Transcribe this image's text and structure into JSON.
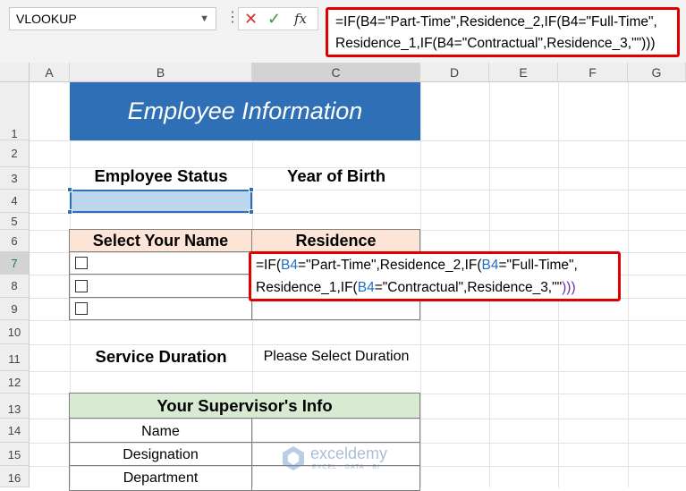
{
  "name_box": {
    "value": "VLOOKUP"
  },
  "formula_bar": {
    "line1": "=IF(B4=\"Part-Time\",Residence_2,IF(B4=\"Full-Time\",",
    "line2": "Residence_1,IF(B4=\"Contractual\",Residence_3,\"\")))"
  },
  "columns": [
    "A",
    "B",
    "C",
    "D",
    "E",
    "F",
    "G"
  ],
  "rows": [
    "1",
    "2",
    "3",
    "4",
    "5",
    "6",
    "7",
    "8",
    "9",
    "10",
    "11",
    "12",
    "13",
    "14",
    "15",
    "16"
  ],
  "sheet": {
    "title": "Employee Information",
    "employee_status_label": "Employee Status",
    "year_of_birth_label": "Year of Birth",
    "table_header_name": "Select Your Name",
    "table_header_residence": "Residence",
    "cell_formula": {
      "eq": "=IF(",
      "ref1": "B4",
      "p1": "=\"Part-Time\",Residence_2,IF(",
      "ref2": "B4",
      "p2": "=\"Full-Time\",",
      "p3": "Residence_1,IF(",
      "ref3": "B4",
      "p4": "=\"Contractual\",Residence_3,\"\"",
      "close": ")))"
    },
    "service_duration_label": "Service Duration",
    "service_duration_value": "Please Select Duration",
    "supervisor_header": "Your Supervisor's Info",
    "supervisor_fields": [
      "Name",
      "Designation",
      "Department"
    ]
  },
  "watermark": {
    "name": "exceldemy",
    "tagline": "EXCEL · DATA · BI"
  },
  "colors": {
    "banner": "#2f6fb5",
    "highlight_red": "#e00000",
    "peach": "#fce4d6",
    "green": "#d9ead3"
  }
}
